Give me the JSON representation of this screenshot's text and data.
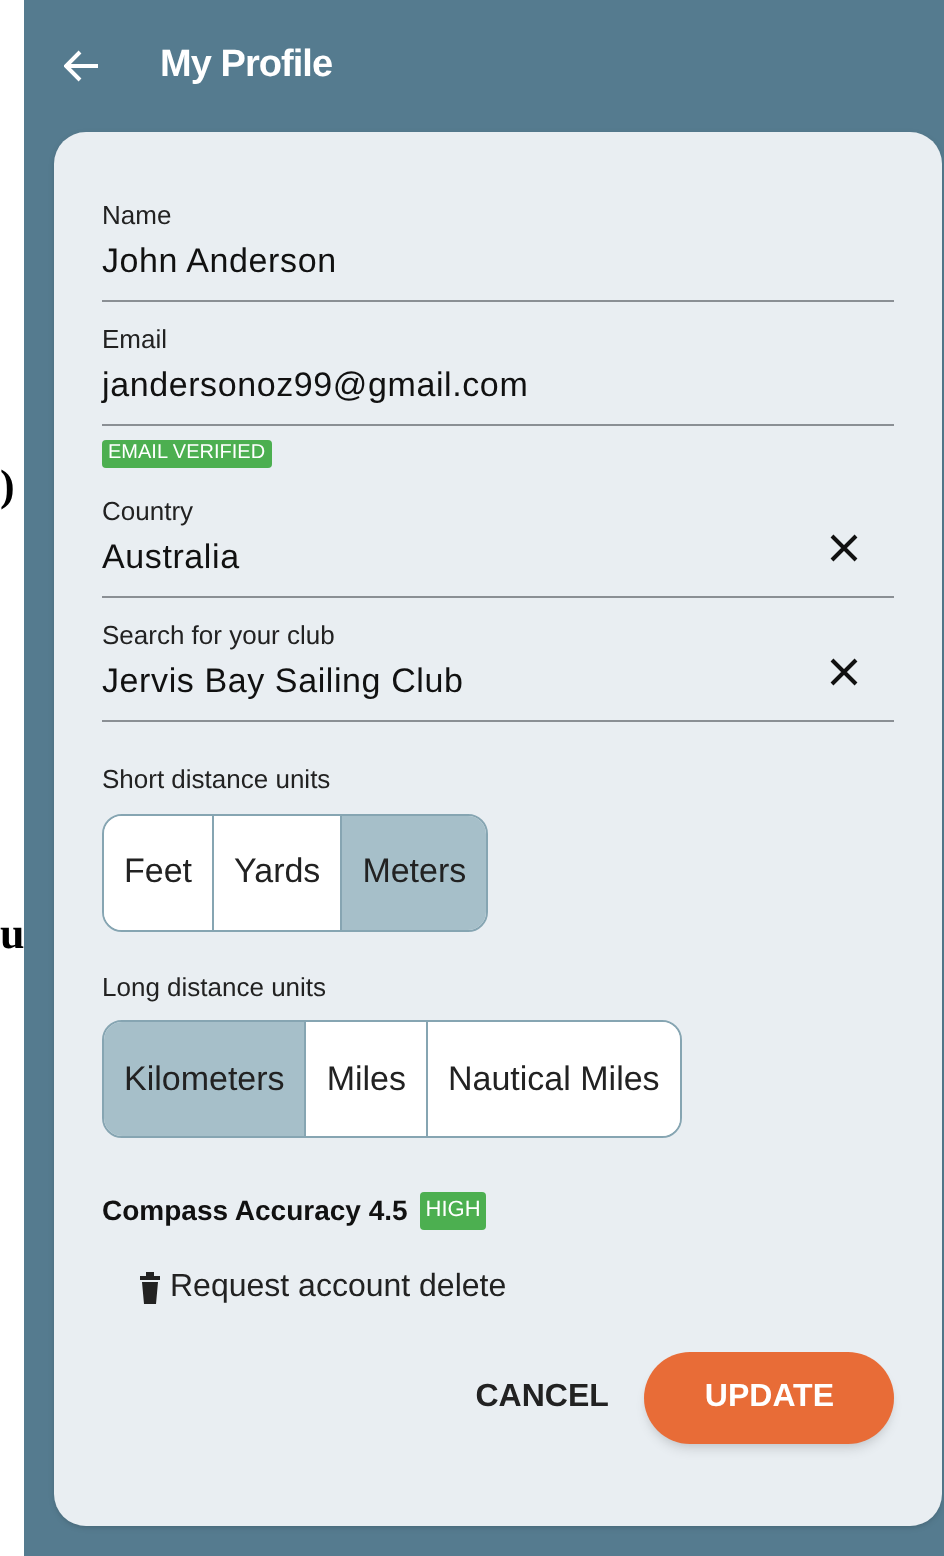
{
  "background_fragments": [
    ")",
    "u"
  ],
  "header": {
    "title": "My Profile"
  },
  "fields": [
    {
      "label": "Name",
      "value": "John Anderson",
      "clearable": false
    },
    {
      "label": "Email",
      "value": "jandersonoz99@gmail.com",
      "clearable": false,
      "badge": "EMAIL VERIFIED"
    },
    {
      "label": "Country",
      "value": "Australia",
      "clearable": true
    },
    {
      "label": "Search for your club",
      "value": "Jervis Bay Sailing Club",
      "clearable": true
    }
  ],
  "unit_groups": [
    {
      "label": "Short distance units",
      "options": [
        {
          "label": "Feet",
          "selected": false
        },
        {
          "label": "Yards",
          "selected": false
        },
        {
          "label": "Meters",
          "selected": true
        }
      ]
    },
    {
      "label": "Long distance units",
      "options": [
        {
          "label": "Kilometers",
          "selected": true
        },
        {
          "label": "Miles",
          "selected": false
        },
        {
          "label": "Nautical Miles",
          "selected": false
        }
      ]
    }
  ],
  "compass": {
    "label": "Compass Accuracy 4.5",
    "badge": "HIGH"
  },
  "delete_link": "Request account delete",
  "buttons": [
    {
      "label": "CANCEL",
      "kind": "text"
    },
    {
      "label": "UPDATE",
      "kind": "primary"
    }
  ]
}
